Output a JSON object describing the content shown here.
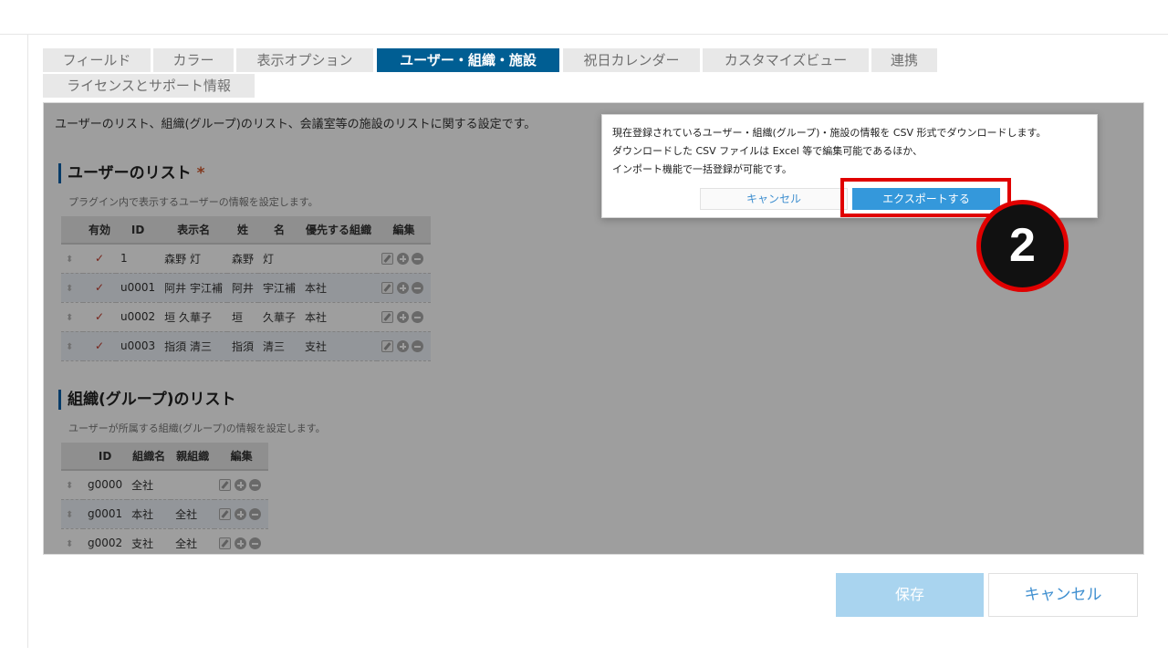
{
  "tabs": [
    {
      "label": "フィールド",
      "active": false
    },
    {
      "label": "カラー",
      "active": false
    },
    {
      "label": "表示オプション",
      "active": false
    },
    {
      "label": "ユーザー・組織・施設",
      "active": true
    },
    {
      "label": "祝日カレンダー",
      "active": false
    },
    {
      "label": "カスタマイズビュー",
      "active": false
    },
    {
      "label": "連携",
      "active": false
    },
    {
      "label": "ライセンスとサポート情報",
      "active": false
    }
  ],
  "intro": "ユーザーのリスト、組織(グループ)のリスト、会議室等の施設のリストに関する設定です。",
  "users": {
    "title": "ユーザーのリスト",
    "required_mark": "*",
    "description": "プラグイン内で表示するユーザーの情報を設定します。",
    "headers": [
      "有効",
      "ID",
      "表示名",
      "姓",
      "名",
      "優先する組織",
      "編集"
    ],
    "rows": [
      {
        "enabled": "✓",
        "id": "1",
        "display": "森野 灯",
        "last": "森野",
        "first": "灯",
        "org": ""
      },
      {
        "enabled": "✓",
        "id": "u0001",
        "display": "阿井 宇江補",
        "last": "阿井",
        "first": "宇江補",
        "org": "本社"
      },
      {
        "enabled": "✓",
        "id": "u0002",
        "display": "垣 久華子",
        "last": "垣",
        "first": "久華子",
        "org": "本社"
      },
      {
        "enabled": "✓",
        "id": "u0003",
        "display": "指須 清三",
        "last": "指須",
        "first": "清三",
        "org": "支社"
      }
    ]
  },
  "orgs": {
    "title": "組織(グループ)のリスト",
    "description": "ユーザーが所属する組織(グループ)の情報を設定します。",
    "headers": [
      "ID",
      "組織名",
      "親組織",
      "編集"
    ],
    "rows": [
      {
        "id": "g0000",
        "name": "全社",
        "parent": ""
      },
      {
        "id": "g0001",
        "name": "本社",
        "parent": "全社"
      },
      {
        "id": "g0002",
        "name": "支社",
        "parent": "全社"
      }
    ]
  },
  "dialog": {
    "line1": "現在登録されているユーザー・組織(グループ)・施設の情報を CSV 形式でダウンロードします。",
    "line2": "ダウンロードした CSV ファイルは Excel 等で編集可能であるほか、",
    "line3": "インポート機能で一括登録が可能です。",
    "cancel_label": "キャンセル",
    "export_label": "エクスポートする"
  },
  "step_badge": "2",
  "footer": {
    "save_label": "保存",
    "cancel_label": "キャンセル"
  }
}
